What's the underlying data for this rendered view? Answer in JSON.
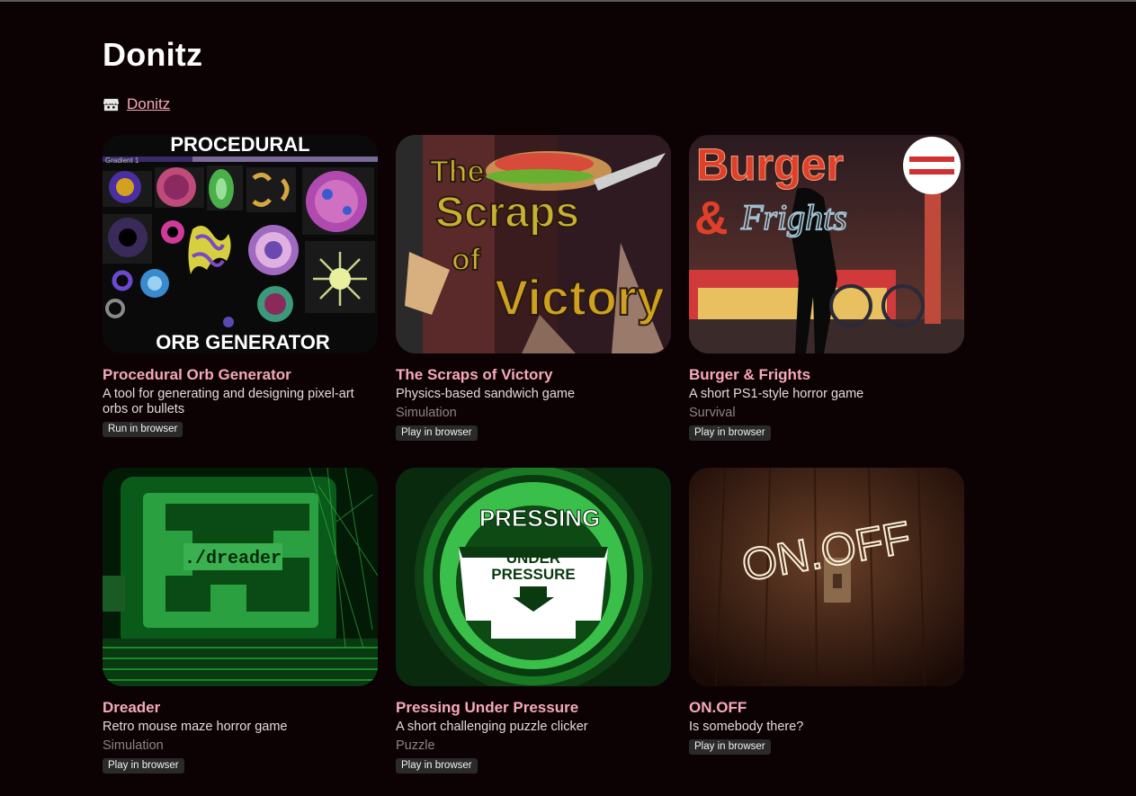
{
  "page": {
    "title": "Donitz",
    "author_icon": "itchio-icon",
    "author_name": "Donitz"
  },
  "games": [
    {
      "title": "Procedural Orb Generator",
      "description": "A tool for generating and designing pixel-art orbs or bullets",
      "genre": "",
      "platform": "Run in browser",
      "thumb_text_top": "PROCEDURAL",
      "thumb_text_bottom": "ORB GENERATOR",
      "thumb_small_label": "Gradient 1"
    },
    {
      "title": "The Scraps of Victory",
      "description": "Physics-based sandwich game",
      "genre": "Simulation",
      "platform": "Play in browser",
      "thumb_text_1": "The",
      "thumb_text_2": "Scraps",
      "thumb_text_3": "of",
      "thumb_text_4": "Victory"
    },
    {
      "title": "Burger & Frights",
      "description": "A short PS1-style horror game",
      "genre": "Survival",
      "platform": "Play in browser",
      "thumb_text_1": "Burger",
      "thumb_text_2": "&",
      "thumb_text_3": "Frights"
    },
    {
      "title": "Dreader",
      "description": "Retro mouse maze horror game",
      "genre": "Simulation",
      "platform": "Play in browser",
      "thumb_text": "./dreader"
    },
    {
      "title": "Pressing Under Pressure",
      "description": "A short challenging puzzle clicker",
      "genre": "Puzzle",
      "platform": "Play in browser",
      "thumb_text_1": "PRESSING",
      "thumb_text_2": "UNDER",
      "thumb_text_3": "PRESSURE"
    },
    {
      "title": "ON.OFF",
      "description": "Is somebody there?",
      "genre": "",
      "platform": "Play in browser",
      "thumb_text": "ON.OFF"
    }
  ],
  "colors": {
    "background": "#0c0204",
    "title_link": "#f7a9b8",
    "badge_bg": "#2b2a2b"
  }
}
